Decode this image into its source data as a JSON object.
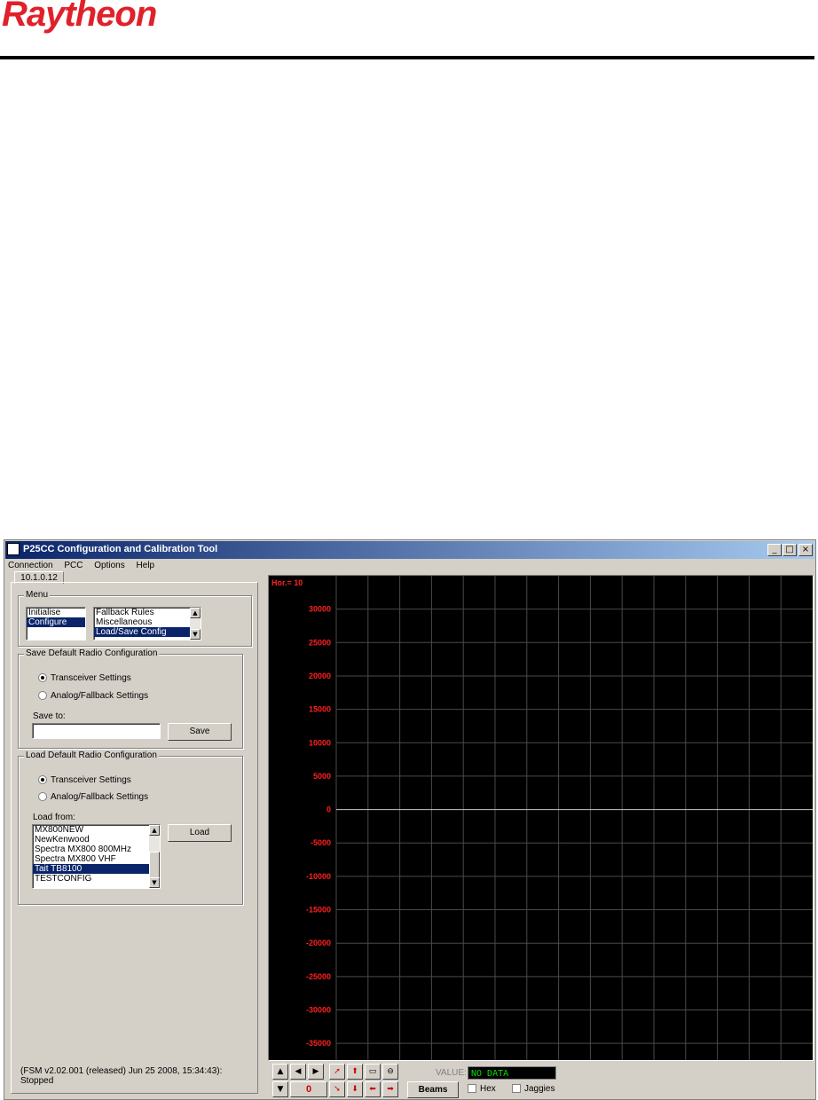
{
  "header": {
    "logo_text": "Raytheon"
  },
  "window": {
    "title": "P25CC Configuration and Calibration Tool",
    "controls": [
      "_",
      "□",
      "×"
    ]
  },
  "menubar": [
    "Connection",
    "PCC",
    "Options",
    "Help"
  ],
  "tab": {
    "label": "10.1.0.12"
  },
  "menu_group": {
    "label": "Menu",
    "left_list": [
      {
        "text": "Initialise",
        "selected": false
      },
      {
        "text": "Configure",
        "selected": true
      }
    ],
    "right_list": [
      {
        "text": "Fallback Rules",
        "selected": false
      },
      {
        "text": "Miscellaneous",
        "selected": false
      },
      {
        "text": "Load/Save Config",
        "selected": true
      }
    ]
  },
  "save_group": {
    "label": "Save Default Radio Configuration",
    "radio_1": "Transceiver Settings",
    "radio_2": "Analog/Fallback Settings",
    "selected": 1,
    "save_to_label": "Save to:",
    "save_to_value": "",
    "save_button": "Save"
  },
  "load_group": {
    "label": "Load Default Radio Configuration",
    "radio_1": "Transceiver Settings",
    "radio_2": "Analog/Fallback Settings",
    "selected": 1,
    "load_from_label": "Load from:",
    "items": [
      {
        "text": "MX800NEW",
        "selected": false
      },
      {
        "text": "NewKenwood",
        "selected": false
      },
      {
        "text": "Spectra MX800 800MHz",
        "selected": false
      },
      {
        "text": "Spectra MX800 VHF",
        "selected": false
      },
      {
        "text": "Tait TB8100",
        "selected": true
      },
      {
        "text": "TESTCONFIG",
        "selected": false
      }
    ],
    "load_button": "Load"
  },
  "status": {
    "line1": "(FSM v2.02.001 (released) Jun 25 2008, 15:34:43):",
    "line2": "Stopped"
  },
  "chart_data": {
    "type": "line",
    "title": "",
    "corner_label": "Hor.= 10",
    "xlabel": "",
    "ylabel": "",
    "ylim": [
      -37500,
      35000
    ],
    "y_ticks": [
      30000,
      25000,
      20000,
      15000,
      10000,
      5000,
      0,
      -5000,
      -10000,
      -15000,
      -20000,
      -25000,
      -30000,
      -35000
    ],
    "x_gridlines": 15,
    "grid": true,
    "series": [],
    "colors": {
      "background": "#000000",
      "grid": "#4a4a4a",
      "zero_line": "#c8c8c8",
      "labels": "#ff2020"
    }
  },
  "controls": {
    "counter_value": "0",
    "value_label": "VALUE:",
    "value_readout": "NO DATA",
    "beams_button": "Beams",
    "hex_label": "Hex",
    "jaggies_label": "Jaggies",
    "icons": [
      "arrow-up-icon",
      "arrow-left-icon",
      "arrow-right-icon",
      "arrow-diag-up-icon",
      "arrow-up-red-icon",
      "folder-open-icon",
      "zoom-out-icon",
      "arrow-down-icon",
      "arrow-diag-down-icon",
      "arrow-down-red-icon",
      "arrow-left-red-icon",
      "arrow-right-red-icon"
    ]
  }
}
